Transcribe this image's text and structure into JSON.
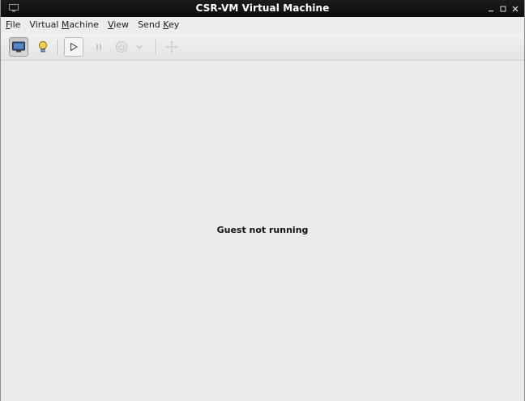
{
  "window": {
    "title": "CSR-VM Virtual Machine",
    "controls": {
      "minimize_icon": "minimize-icon",
      "maximize_icon": "maximize-icon",
      "close_icon": "close-icon"
    }
  },
  "menubar": {
    "items": [
      {
        "pre": "",
        "mnemonic": "F",
        "post": "ile"
      },
      {
        "pre": "Virtual ",
        "mnemonic": "M",
        "post": "achine"
      },
      {
        "pre": "",
        "mnemonic": "V",
        "post": "iew"
      },
      {
        "pre": "Send ",
        "mnemonic": "K",
        "post": "ey"
      }
    ]
  },
  "toolbar": {
    "buttons": [
      {
        "icon": "console-icon",
        "state": "pressed"
      },
      {
        "icon": "details-bulb-icon",
        "state": "normal"
      },
      {
        "icon": "run-icon",
        "state": "framed"
      },
      {
        "icon": "pause-icon",
        "state": "disabled"
      },
      {
        "icon": "shutdown-icon",
        "state": "disabled"
      },
      {
        "icon": "chevron-down-icon",
        "state": "disabled"
      },
      {
        "icon": "fullscreen-icon",
        "state": "disabled"
      }
    ]
  },
  "content": {
    "status_text": "Guest not running"
  },
  "colors": {
    "titlebar": "#111111",
    "menubar": "#ededeb",
    "content": "#ebebe9",
    "console_icon": "#3a5a8c",
    "bulb_icon": "#e8c53a"
  }
}
